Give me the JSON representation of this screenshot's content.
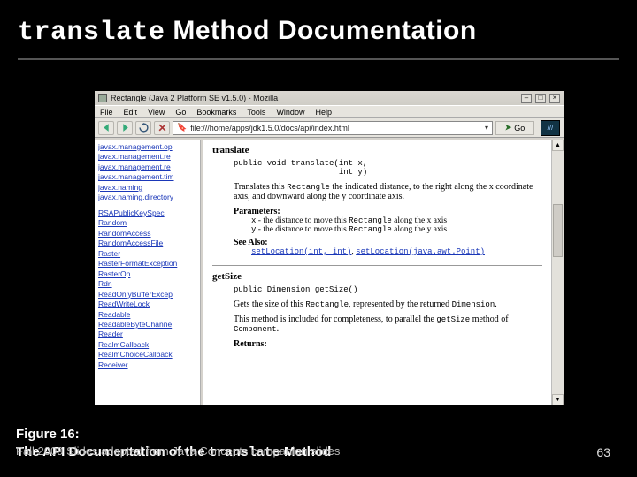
{
  "slide": {
    "title_mono": "translate",
    "title_rest": " Method Documentation",
    "page_number": "63"
  },
  "caption": {
    "figure_label": "Figure 16:",
    "text_prefix": "The API Documentation of the ",
    "text_mono": "translate",
    "text_suffix": " Method",
    "footer_overlap": "Fall 2009     Slides adapted from Java Concepts companion slides"
  },
  "browser": {
    "window_title": "Rectangle (Java 2 Platform SE v1.5.0) - Mozilla",
    "menus": [
      "File",
      "Edit",
      "View",
      "Go",
      "Bookmarks",
      "Tools",
      "Window",
      "Help"
    ],
    "url_value": "file:///home/apps/jdk1.5.0/docs/api/index.html",
    "go_label": "Go"
  },
  "sidebar_links": [
    "javax.management.op",
    "javax.management.re",
    "javax.management.re",
    "javax.management.tim",
    "javax.naming",
    "javax.naming.directory",
    "",
    "RSAPublicKeySpec",
    "Random",
    "RandomAccess",
    "RandomAccessFile",
    "Raster",
    "RasterFormatException",
    "RasterOp",
    "Rdn",
    "ReadOnlyBufferExcep",
    "ReadWriteLock",
    "Readable",
    "ReadableByteChanne",
    "Reader",
    "RealmCallback",
    "RealmChoiceCallback",
    "Receiver"
  ],
  "doc": {
    "method1": {
      "name": "translate",
      "sig_line1": "public void translate(int x,",
      "sig_line2": "                      int y)",
      "desc_a": "Translates this ",
      "desc_code": "Rectangle",
      "desc_b": " the indicated distance, to the right along the x coordinate axis, and downward along the y coordinate axis.",
      "params_label": "Parameters:",
      "px_name": "x",
      "px_text": " - the distance to move this ",
      "px_code": "Rectangle",
      "px_tail": " along the x axis",
      "py_name": "y",
      "py_text": " - the distance to move this ",
      "py_code": "Rectangle",
      "py_tail": " along the y axis",
      "see_label": "See Also:",
      "see1": "setLocation(int, int)",
      "see2": "setLocation(java.awt.Point)"
    },
    "method2": {
      "name": "getSize",
      "sig": "public Dimension getSize()",
      "desc_a": "Gets the size of this ",
      "desc_code1": "Rectangle",
      "desc_b": ", represented by the returned ",
      "desc_code2": "Dimension",
      "desc_c": ".",
      "note_a": "This method is included for completeness, to parallel the ",
      "note_code": "getSize",
      "note_b": " method of ",
      "note_code2": "Component",
      "note_c": ".",
      "returns_label": "Returns:"
    }
  }
}
